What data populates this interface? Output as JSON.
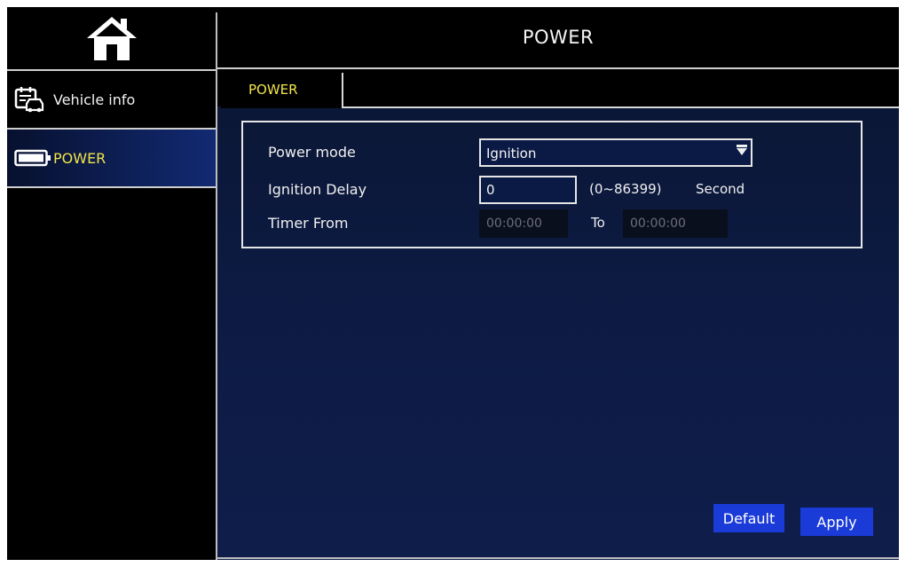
{
  "sidebar": {
    "home_icon": "home-icon",
    "items": [
      {
        "label": "Vehicle info",
        "icon": "vehicle-info-icon",
        "selected": false
      },
      {
        "label": "POWER",
        "icon": "battery-icon",
        "selected": true
      }
    ]
  },
  "header": {
    "title": "POWER"
  },
  "tabs": [
    {
      "label": "POWER",
      "active": true
    }
  ],
  "form": {
    "power_mode": {
      "label": "Power mode",
      "value": "Ignition"
    },
    "ignition_delay": {
      "label": "Ignition Delay",
      "value": "0",
      "range": "(0~86399)",
      "unit": "Second"
    },
    "timer": {
      "label": "Timer From",
      "from": "00:00:00",
      "to_label": "To",
      "to": "00:00:00"
    }
  },
  "buttons": {
    "default": "Default",
    "apply": "Apply"
  },
  "colors": {
    "accent_yellow": "#f1e44a",
    "button_blue": "#1a3bd8",
    "panel_navy": "#0d1b44"
  }
}
